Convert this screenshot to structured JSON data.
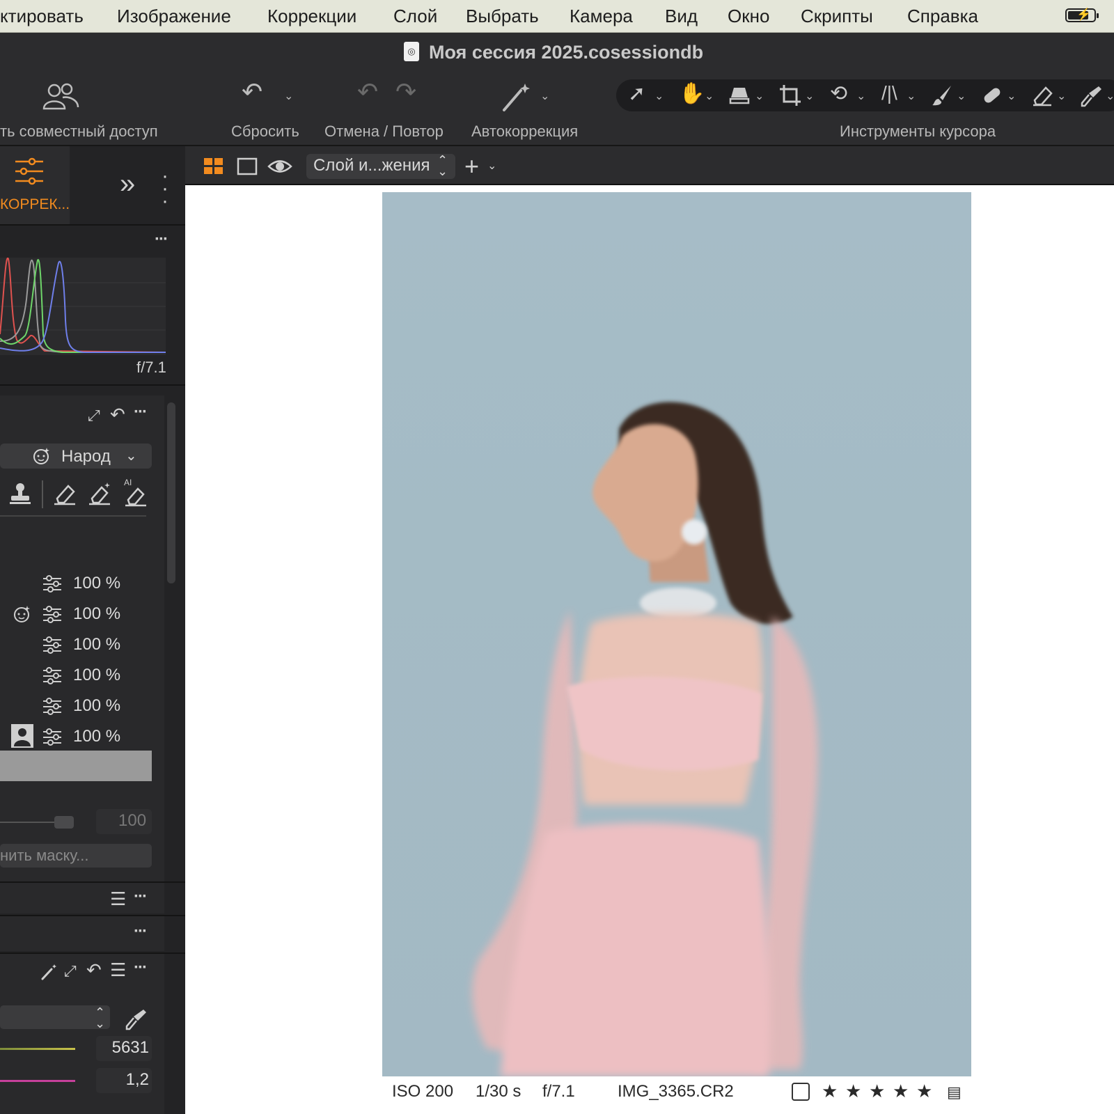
{
  "menu": {
    "items": [
      "ктировать",
      "Изображение",
      "Коррекции",
      "Слой",
      "Выбрать",
      "Камера",
      "Вид",
      "Окно",
      "Скрипты",
      "Справка"
    ],
    "battery_level": 0.8
  },
  "window": {
    "title": "Моя сессия 2025.cosessiondb"
  },
  "toolbar": {
    "share_label": "ть совместный доступ",
    "reset_label": "Сбросить",
    "undo_redo_label": "Отмена / Повтор",
    "autocorrect_label": "Автокоррекция",
    "cursor_tools_label": "Инструменты курсора",
    "cursor_tools": [
      "select-cursor-icon",
      "pan-hand-icon",
      "keystone-icon",
      "crop-icon",
      "rotate-icon",
      "straighten-icon",
      "brush-icon",
      "heal-icon",
      "erase-icon",
      "picker-icon"
    ],
    "active_tool": "pan-hand-icon",
    "active_color": "#f28b1f"
  },
  "tool_tabs": {
    "active_label": "КОРРЕК..."
  },
  "histogram": {
    "info": "f/7.1",
    "channel_colors": {
      "red": "#e0524f",
      "green": "#6fd66a",
      "blue": "#6f7fea",
      "luma": "#9a9a9a"
    }
  },
  "layers": {
    "mask_dropdown": "Народ",
    "eraser_tools": [
      "stamp-icon",
      "eraser-icon",
      "magic-eraser-icon",
      "ai-eraser-icon"
    ],
    "ai_badge": "AI",
    "rows": [
      {
        "opacity": "100 %",
        "icon": ""
      },
      {
        "opacity": "100 %",
        "icon": "face-mask-icon"
      },
      {
        "opacity": "100 %",
        "icon": ""
      },
      {
        "opacity": "100 %",
        "icon": ""
      },
      {
        "opacity": "100 %",
        "icon": ""
      },
      {
        "opacity": "100 %",
        "icon": "person-mask-icon"
      }
    ],
    "opacity_value": "100",
    "opacity_level": 1.0,
    "mask_button": "нить маску..."
  },
  "white_balance": {
    "kelvin": "5631",
    "tint": "1,2"
  },
  "viewer": {
    "layer_select": "Слой и...жения",
    "iso": "ISO 200",
    "shutter": "1/30 s",
    "aperture": "f/7.1",
    "filename": "IMG_3365.CR2",
    "stars": [
      "★",
      "★",
      "★",
      "★",
      "★"
    ]
  }
}
